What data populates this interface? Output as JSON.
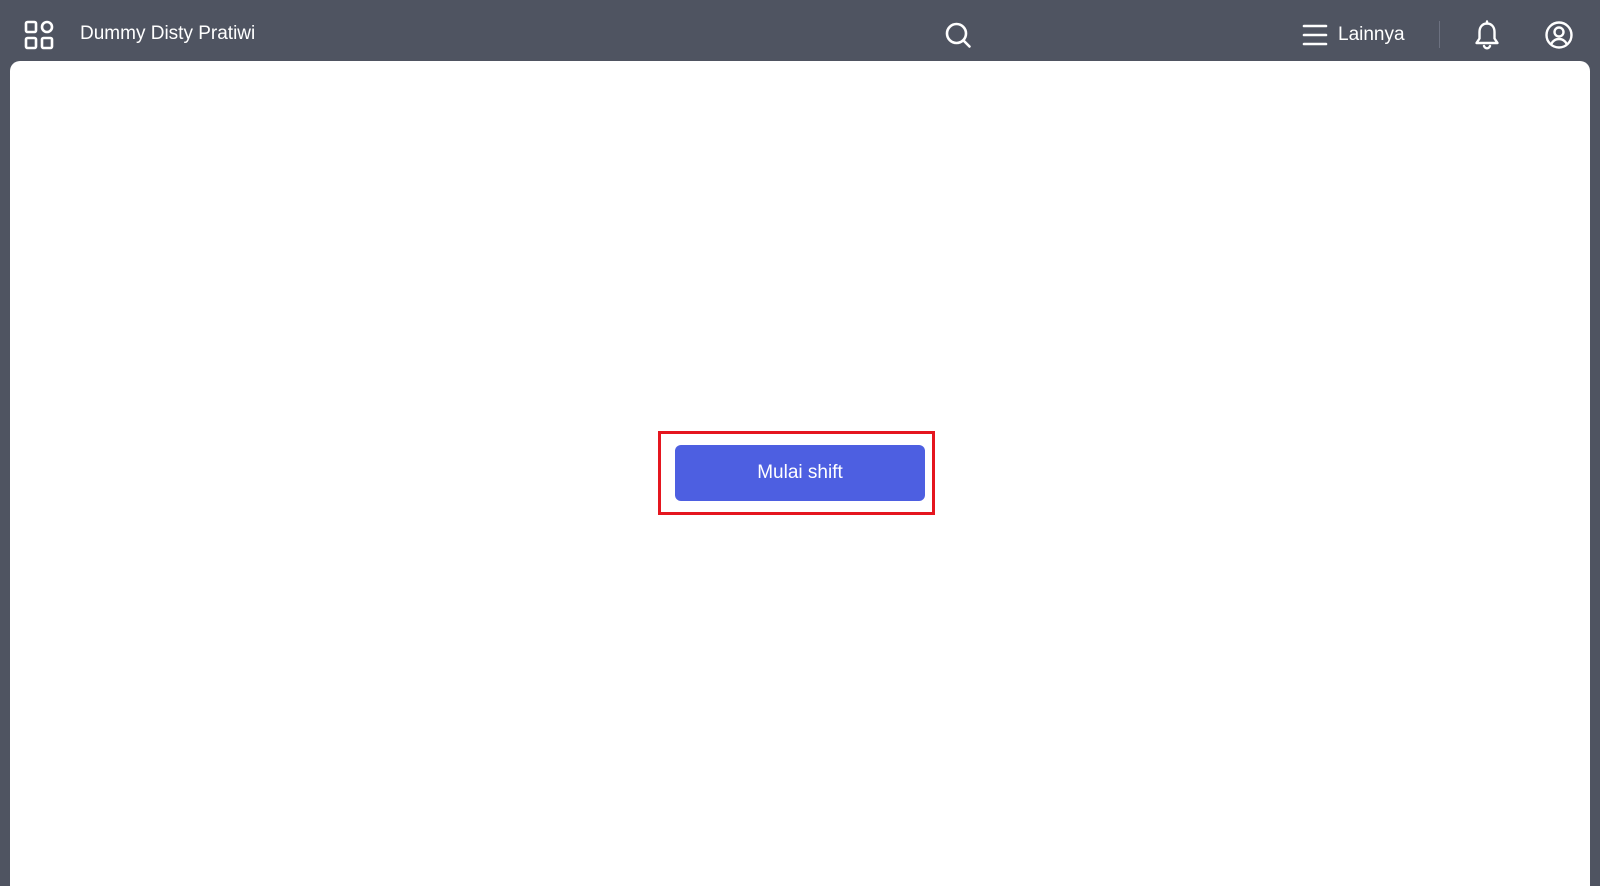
{
  "header": {
    "app_title": "Dummy Disty Pratiwi",
    "more_label": "Lainnya",
    "icons": {
      "apps": "apps-grid-icon",
      "search": "search-icon",
      "menu": "hamburger-menu-icon",
      "notifications": "bell-icon",
      "account": "user-circle-icon"
    }
  },
  "main": {
    "start_shift_label": "Mulai shift"
  },
  "colors": {
    "topbar_background": "#4f5461",
    "content_background": "#ffffff",
    "primary_button": "#4d5fe1",
    "highlight_border": "#e5161f"
  }
}
